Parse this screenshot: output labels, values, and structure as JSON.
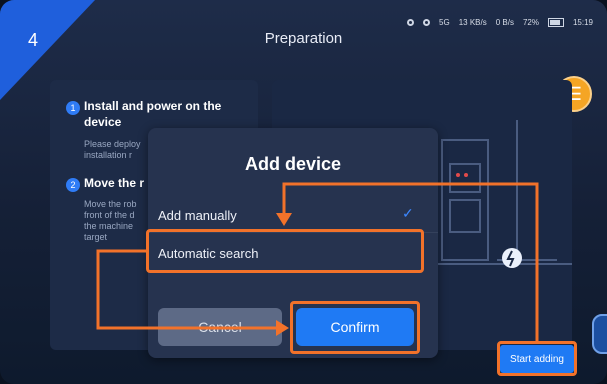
{
  "header": {
    "step_number": "4",
    "title": "Preparation"
  },
  "status_bar": {
    "signal": "5G",
    "speed1": "13 KB/s",
    "speed2": "0 B/s",
    "battery": "72%",
    "time": "15:19"
  },
  "instructions": {
    "step1": {
      "num": "1",
      "title": "Install and power on the device",
      "desc": "Please deploy installation r"
    },
    "step2": {
      "num": "2",
      "title": "Move the r",
      "desc": "Move the rob front of the d the machine target"
    }
  },
  "dialog": {
    "title": "Add device",
    "option_manual": "Add manually",
    "option_auto": "Automatic search",
    "cancel_label": "Cancel",
    "confirm_label": "Confirm"
  },
  "start_adding_label": "Start adding",
  "colors": {
    "accent": "#1f7af4",
    "highlight": "#f2722a",
    "guide": "#f5a524"
  }
}
